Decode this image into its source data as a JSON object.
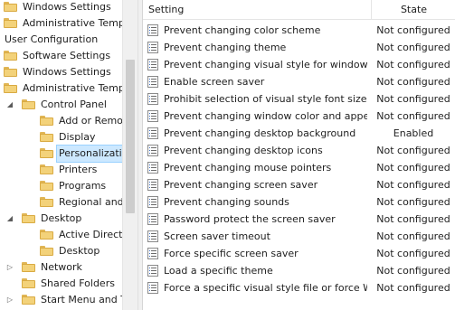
{
  "tree": {
    "items": [
      {
        "label": "Windows Settings",
        "expander": "",
        "selected": false
      },
      {
        "label": "Administrative Templates",
        "expander": "",
        "selected": false
      },
      {
        "label": "User Configuration",
        "expander": "",
        "selected": false
      },
      {
        "label": "Software Settings",
        "expander": "",
        "selected": false
      },
      {
        "label": "Windows Settings",
        "expander": "",
        "selected": false
      },
      {
        "label": "Administrative Templates",
        "expander": "",
        "selected": false
      },
      {
        "label": "Control Panel",
        "expander": "expanded",
        "selected": false
      },
      {
        "label": "Add or Remove Programs",
        "expander": "",
        "selected": false
      },
      {
        "label": "Display",
        "expander": "",
        "selected": false
      },
      {
        "label": "Personalization",
        "expander": "",
        "selected": true
      },
      {
        "label": "Printers",
        "expander": "",
        "selected": false
      },
      {
        "label": "Programs",
        "expander": "",
        "selected": false
      },
      {
        "label": "Regional and Language Options",
        "expander": "",
        "selected": false
      },
      {
        "label": "Desktop",
        "expander": "expanded",
        "selected": false
      },
      {
        "label": "Active Directory",
        "expander": "",
        "selected": false
      },
      {
        "label": "Desktop",
        "expander": "",
        "selected": false
      },
      {
        "label": "Network",
        "expander": "collapsed",
        "selected": false
      },
      {
        "label": "Shared Folders",
        "expander": "",
        "selected": false
      },
      {
        "label": "Start Menu and Taskbar",
        "expander": "collapsed",
        "selected": false
      }
    ]
  },
  "list": {
    "columns": {
      "setting": "Setting",
      "state": "State"
    },
    "rows": [
      {
        "setting": "Prevent changing color scheme",
        "state": "Not configured"
      },
      {
        "setting": "Prevent changing theme",
        "state": "Not configured"
      },
      {
        "setting": "Prevent changing visual style for windows and buttons",
        "state": "Not configured"
      },
      {
        "setting": "Enable screen saver",
        "state": "Not configured"
      },
      {
        "setting": "Prohibit selection of visual style font size",
        "state": "Not configured"
      },
      {
        "setting": "Prevent changing window color and appearance",
        "state": "Not configured"
      },
      {
        "setting": "Prevent changing desktop background",
        "state": "Enabled"
      },
      {
        "setting": "Prevent changing desktop icons",
        "state": "Not configured"
      },
      {
        "setting": "Prevent changing mouse pointers",
        "state": "Not configured"
      },
      {
        "setting": "Prevent changing screen saver",
        "state": "Not configured"
      },
      {
        "setting": "Prevent changing sounds",
        "state": "Not configured"
      },
      {
        "setting": "Password protect the screen saver",
        "state": "Not configured"
      },
      {
        "setting": "Screen saver timeout",
        "state": "Not configured"
      },
      {
        "setting": "Force specific screen saver",
        "state": "Not configured"
      },
      {
        "setting": "Load a specific theme",
        "state": "Not configured"
      },
      {
        "setting": "Force a specific visual style file or force Windows Classic",
        "state": "Not configured"
      }
    ]
  }
}
